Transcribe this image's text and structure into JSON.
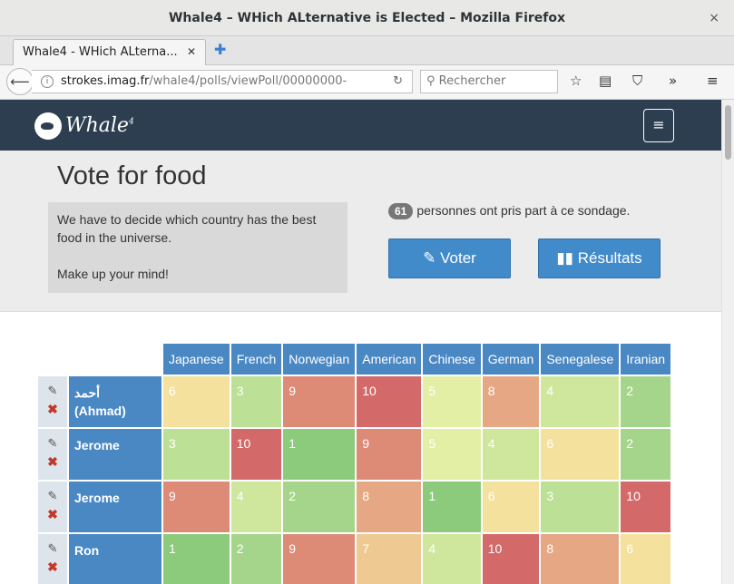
{
  "window": {
    "title": "Whale4 – WHich ALternative is Elected – Mozilla Firefox",
    "close": "×"
  },
  "tab": {
    "label": "Whale4 - WHich ALterna...",
    "close": "✕",
    "new": "✚"
  },
  "navbar": {
    "url_host": "strokes.imag.fr",
    "url_path": "/whale4/polls/viewPoll/00000000-",
    "search_placeholder": "Rechercher"
  },
  "app": {
    "logo": "Whale",
    "logo_sup": "4",
    "menu": "≡"
  },
  "poll": {
    "title": "Vote for food",
    "description_1": "We have to decide which country has the best food in the universe.",
    "description_2": "Make up your mind!",
    "participants_count": "61",
    "participants_text": "personnes ont pris part à ce sondage.",
    "vote_label": "Voter",
    "results_label": "Résultats"
  },
  "table": {
    "columns": [
      "Japanese",
      "French",
      "Norwegian",
      "American",
      "Chinese",
      "German",
      "Senegalese",
      "Iranian"
    ],
    "rows": [
      {
        "name": "أحمد\n(Ahmad)",
        "scores": [
          "6",
          "3",
          "9",
          "10",
          "5",
          "8",
          "4",
          "2"
        ]
      },
      {
        "name": "Jerome",
        "scores": [
          "3",
          "10",
          "1",
          "9",
          "5",
          "4",
          "6",
          "2"
        ]
      },
      {
        "name": "Jerome",
        "scores": [
          "9",
          "4",
          "2",
          "8",
          "1",
          "6",
          "3",
          "10"
        ]
      },
      {
        "name": "Ron",
        "scores": [
          "1",
          "2",
          "9",
          "7",
          "4",
          "10",
          "8",
          "6"
        ]
      }
    ]
  },
  "colors": {
    "1": "#8ccb7c",
    "2": "#a5d58a",
    "3": "#bbe096",
    "4": "#cfe79d",
    "5": "#e2efa5",
    "6": "#f3e19d",
    "7": "#efc992",
    "8": "#e6a884",
    "9": "#dd8a77",
    "10": "#d4696a"
  }
}
